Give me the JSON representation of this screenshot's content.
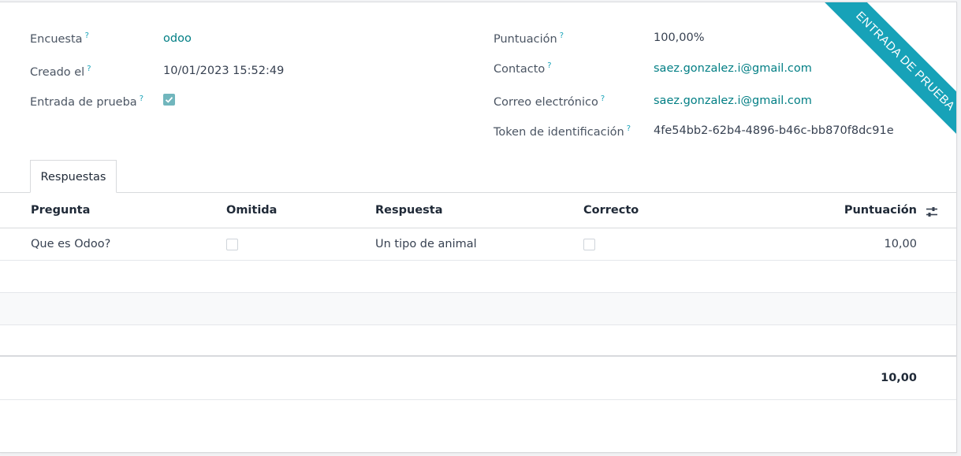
{
  "form": {
    "ribbon": "ENTRADA DE PRUEBA",
    "help_glyph": "?",
    "left": {
      "survey_label": "Encuesta",
      "survey_value": "odoo",
      "created_label": "Creado el",
      "created_value": "10/01/2023 15:52:49",
      "test_entry_label": "Entrada de prueba",
      "test_entry_checked": true
    },
    "right": {
      "score_label": "Puntuación",
      "score_value": "100,00%",
      "contact_label": "Contacto",
      "contact_value": "saez.gonzalez.i@gmail.com",
      "email_label": "Correo electrónico",
      "email_value": "saez.gonzalez.i@gmail.com",
      "token_label": "Token de identificación",
      "token_value": "4fe54bb2-62b4-4896-b46c-bb870f8dc91e"
    }
  },
  "tabs": [
    {
      "label": "Respuestas"
    }
  ],
  "table": {
    "columns": [
      "Pregunta",
      "Omitida",
      "Respuesta",
      "Correcto",
      "Puntuación"
    ],
    "rows": [
      {
        "question": "Que es Odoo?",
        "skipped": false,
        "answer": "Un tipo de animal",
        "correct": false,
        "score": "10,00"
      }
    ],
    "total": "10,00"
  },
  "colors": {
    "accent": "#017e84",
    "ribbon": "#17a2b8",
    "checkbox": "#71b6bd"
  },
  "icons": {
    "settings": "optional-columns-sliders-icon"
  }
}
